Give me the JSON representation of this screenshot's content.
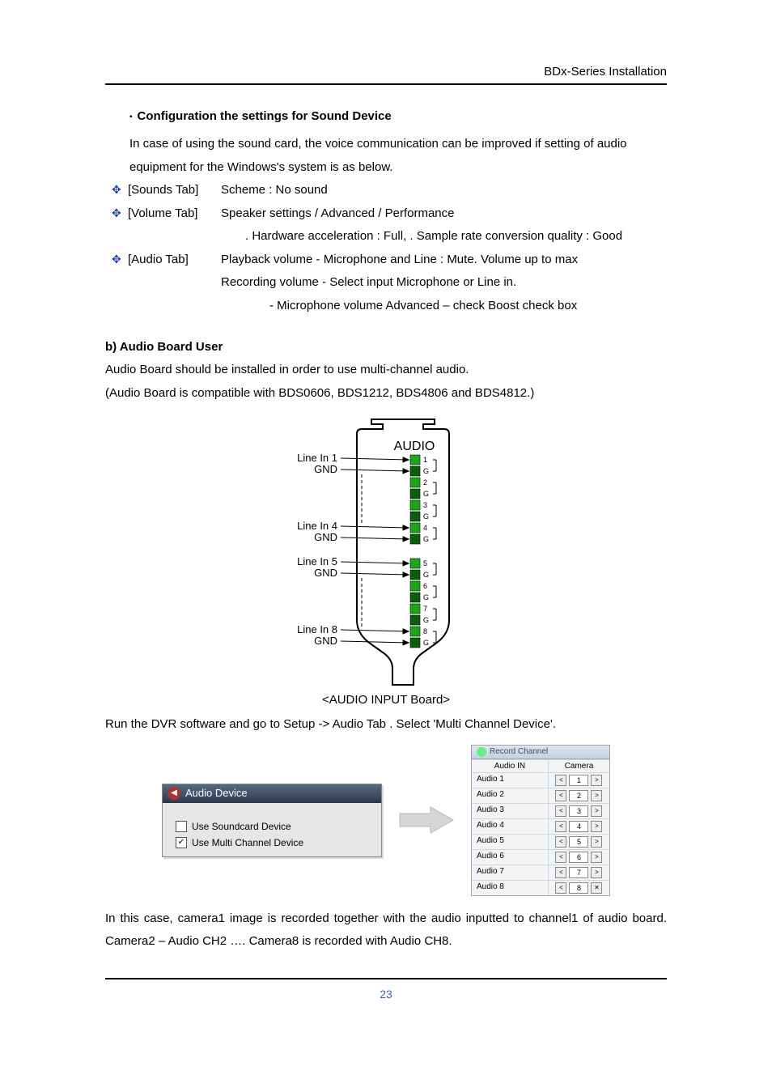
{
  "header": {
    "right": "BDx-Series Installation"
  },
  "section1": {
    "heading": "Configuration the settings for Sound Device",
    "intro": "In case of using the sound card, the voice communication can be improved if setting of audio equipment for the Windows's system is as below.",
    "tabs": [
      {
        "label": "[Sounds Tab]",
        "desc": "Scheme : No sound"
      },
      {
        "label": "[Volume Tab]",
        "desc": "Speaker settings / Advanced / Performance",
        "cont": ". Hardware acceleration : Full,    . Sample rate conversion quality : Good"
      },
      {
        "label": "[Audio Tab]",
        "desc": "Playback volume - Microphone and Line : Mute.    Volume up to max",
        "cont": "Recording volume - Select input Microphone or Line in.",
        "cont2": "- Microphone volume Advanced – check Boost check box"
      }
    ]
  },
  "section2": {
    "heading": "b) Audio Board User",
    "p1": "Audio Board should be installed in order to use multi-channel audio.",
    "p2": "(Audio Board is compatible with BDS0606, BDS1212, BDS4806 and BDS4812.)",
    "diagram": {
      "title": "AUDIO",
      "left_labels": [
        {
          "a": "Line In 1",
          "b": "GND"
        },
        {
          "a": "Line In 4",
          "b": "GND"
        },
        {
          "a": "Line In 5",
          "b": "GND"
        },
        {
          "a": "Line In 8",
          "b": "GND"
        }
      ],
      "pins_top": [
        "1",
        "G",
        "2",
        "G",
        "3",
        "G",
        "4",
        "G"
      ],
      "pins_bot": [
        "5",
        "G",
        "6",
        "G",
        "7",
        "G",
        "8",
        "G"
      ],
      "caption": "<AUDIO INPUT Board>"
    },
    "p3": "Run the DVR software and go to Setup -> Audio Tab .    Select 'Multi Channel Device'."
  },
  "audio_device_panel": {
    "title": "Audio Device",
    "opt_soundcard": "Use Soundcard Device",
    "opt_multichannel": "Use Multi Channel Device",
    "soundcard_checked": false,
    "multichannel_checked": true
  },
  "record_panel": {
    "title": "Record Channel",
    "col_a": "Audio IN",
    "col_b": "Camera",
    "rows": [
      {
        "label": "Audio 1",
        "value": "1"
      },
      {
        "label": "Audio 2",
        "value": "2"
      },
      {
        "label": "Audio 3",
        "value": "3"
      },
      {
        "label": "Audio 4",
        "value": "4"
      },
      {
        "label": "Audio 5",
        "value": "5"
      },
      {
        "label": "Audio 6",
        "value": "6"
      },
      {
        "label": "Audio 7",
        "value": "7"
      },
      {
        "label": "Audio 8",
        "value": "8"
      }
    ]
  },
  "closing": "In this case, camera1 image is recorded together with the audio inputted to channel1 of audio board. Camera2 – Audio CH2 …. Camera8 is recorded with Audio CH8.",
  "page_number": "23",
  "glyphs": {
    "square": "▪",
    "diamond": "✥",
    "check": "✔",
    "lt": "<",
    "gt": ">",
    "x": "✕"
  }
}
